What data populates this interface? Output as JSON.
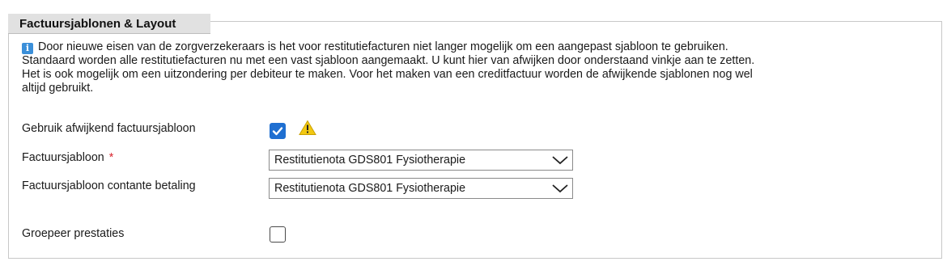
{
  "section": {
    "title": "Factuursjablonen & Layout",
    "info_lines": [
      "Door nieuwe eisen van de zorgverzekeraars is het voor restitutiefacturen niet langer mogelijk om een aangepast sjabloon te gebruiken.",
      "Standaard worden alle restitutiefacturen nu met een vast sjabloon aangemaakt. U kunt hier van afwijken door onderstaand vinkje aan te zetten.",
      "Het is ook mogelijk om een uitzondering per debiteur te maken. Voor het maken van een creditfactuur worden de afwijkende sjablonen nog wel",
      "altijd gebruikt."
    ]
  },
  "fields": {
    "custom_template": {
      "label": "Gebruik afwijkend factuursjabloon",
      "checked": true
    },
    "invoice_template": {
      "label": "Factuursjabloon",
      "required_mark": "*",
      "value": "Restitutienota GDS801 Fysiotherapie"
    },
    "cash_template": {
      "label": "Factuursjabloon contante betaling",
      "value": "Restitutienota GDS801 Fysiotherapie"
    },
    "group_services": {
      "label": "Groepeer prestaties",
      "checked": false
    }
  },
  "colors": {
    "accent": "#1f6fd1",
    "required": "#d9262f",
    "warning": "#f2c811"
  },
  "icons": {
    "info": "info-icon",
    "warning": "warning-icon",
    "dropdown": "chevron-down-icon",
    "check": "checkmark-icon"
  }
}
